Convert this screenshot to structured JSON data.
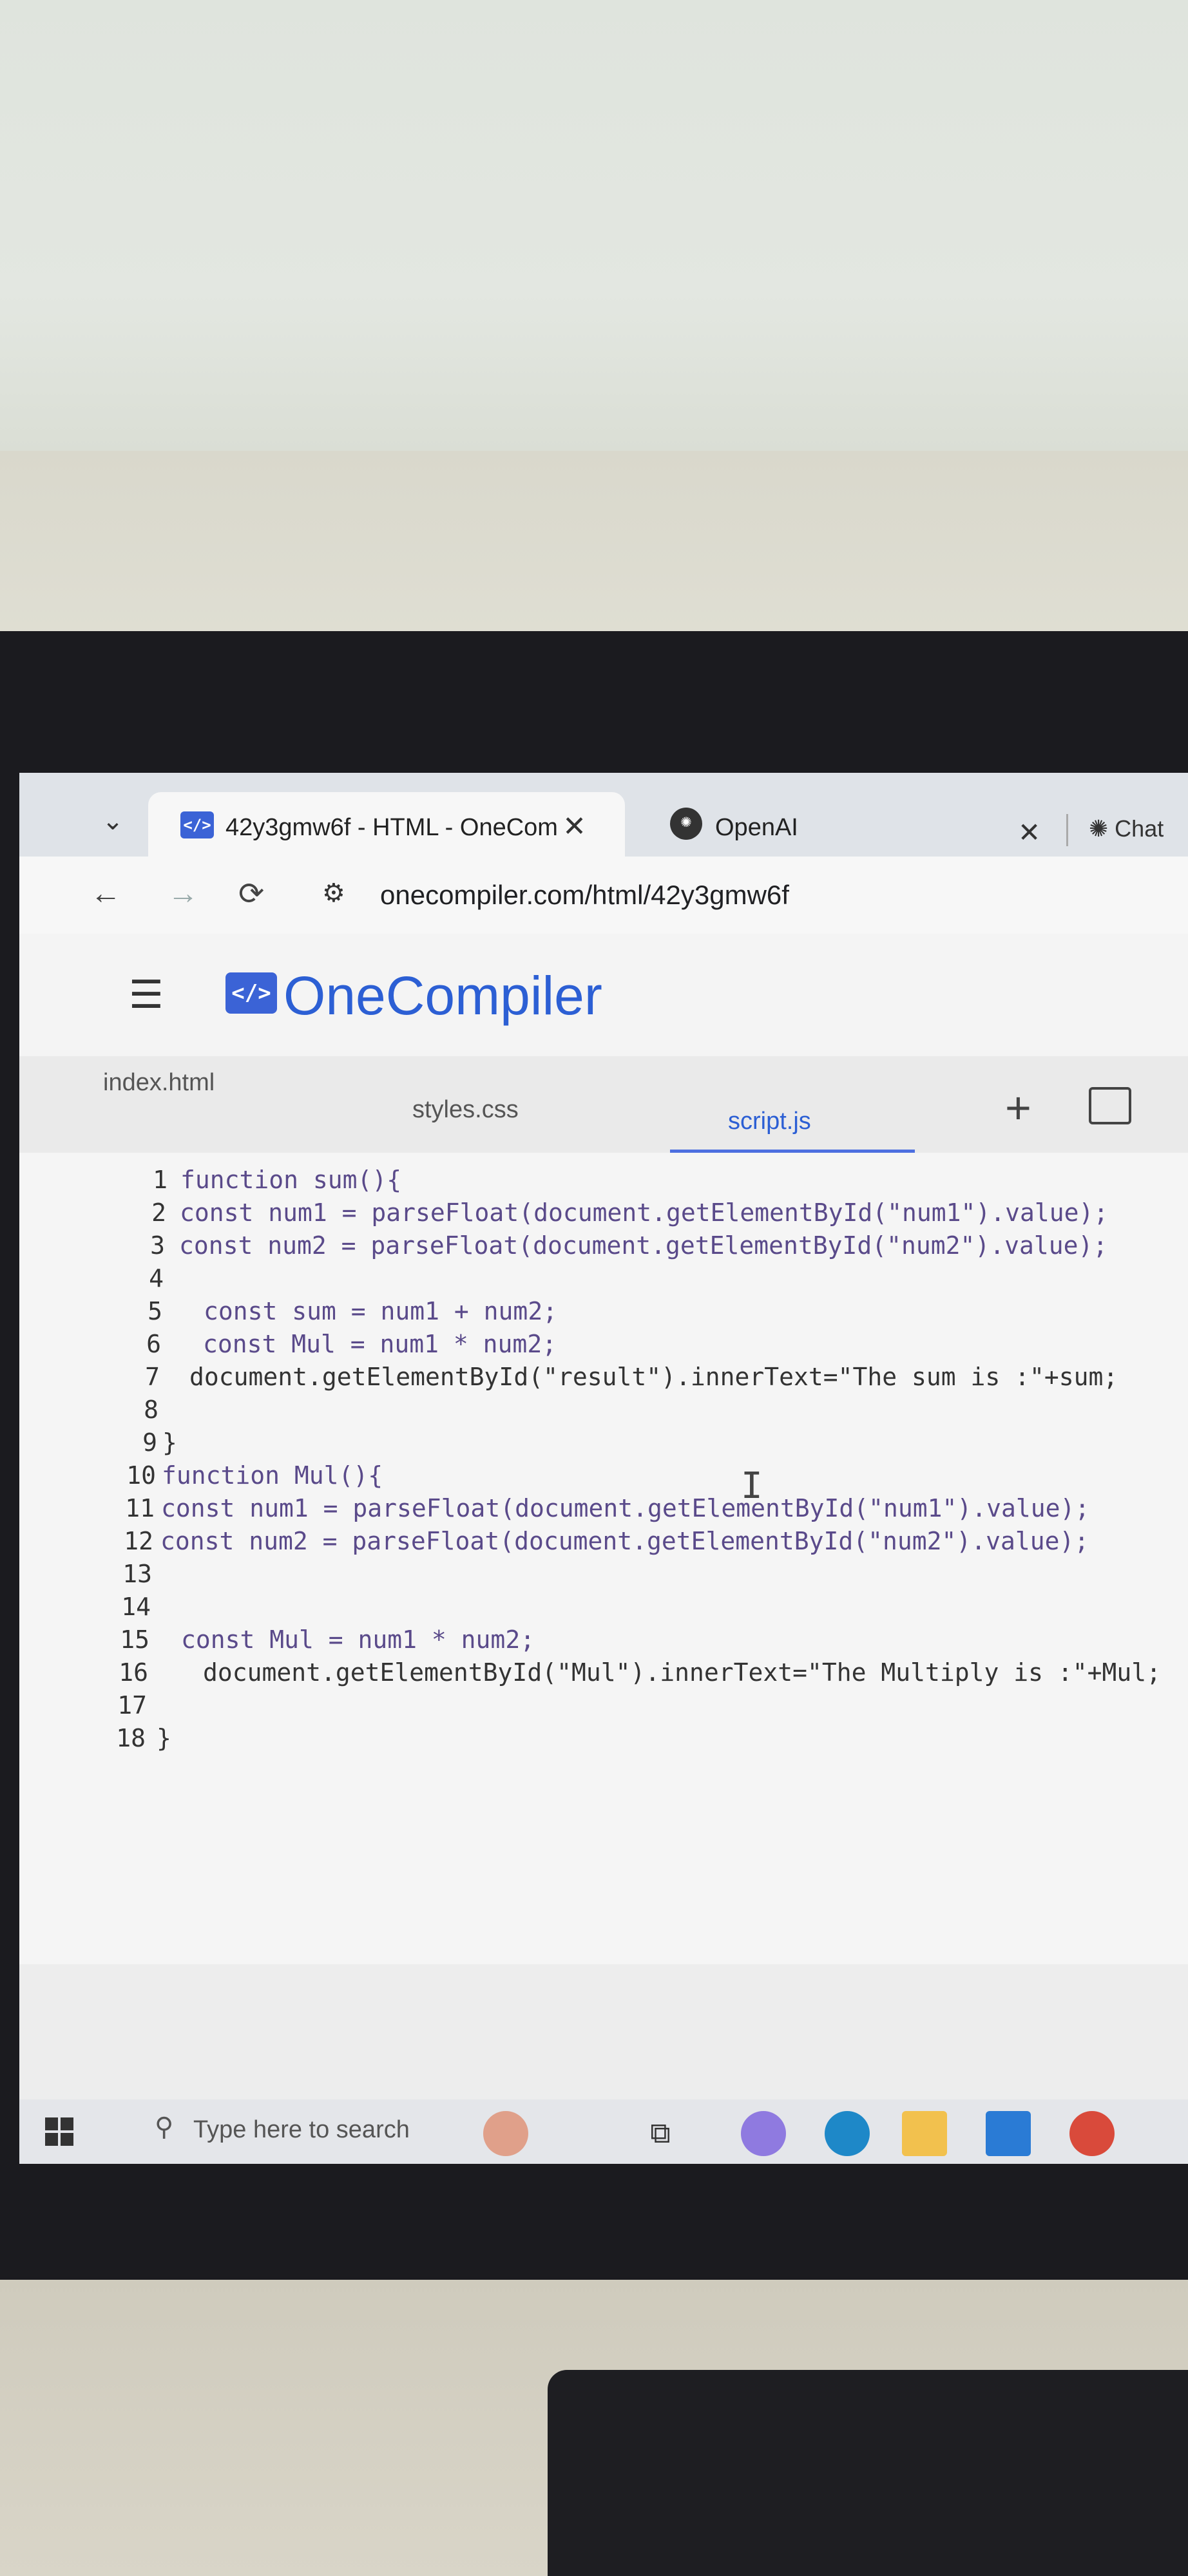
{
  "browser": {
    "tabs": [
      {
        "title": "42y3gmw6f - HTML - OneCom",
        "favicon": "</>"
      },
      {
        "title": "OpenAI",
        "favicon": "openai-logo"
      }
    ],
    "tab_peek": "Chat",
    "url": "onecompiler.com/html/42y3gmw6f"
  },
  "app": {
    "logo_mark": "</>",
    "name": "OneCompiler"
  },
  "file_tabs": [
    "index.html",
    "styles.css",
    "script.js"
  ],
  "active_file": "script.js",
  "code_lines": [
    {
      "n": "1",
      "text": "function sum(){"
    },
    {
      "n": "2",
      "text": "const num1 = parseFloat(document.getElementById(\"num1\").value);"
    },
    {
      "n": "3",
      "text": "const num2 = parseFloat(document.getElementById(\"num2\").value);"
    },
    {
      "n": "4",
      "text": ""
    },
    {
      "n": "5",
      "text": "const sum = num1 + num2;"
    },
    {
      "n": "6",
      "text": "const Mul = num1 * num2;"
    },
    {
      "n": "7",
      "text": "document.getElementById(\"result\").innerText=\"The sum is :\"+sum;"
    },
    {
      "n": "8",
      "text": ""
    },
    {
      "n": "9",
      "text": "}"
    },
    {
      "n": "10",
      "text": "function Mul(){"
    },
    {
      "n": "11",
      "text": "const num1 = parseFloat(document.getElementById(\"num1\").value);"
    },
    {
      "n": "12",
      "text": "const num2 = parseFloat(document.getElementById(\"num2\").value);"
    },
    {
      "n": "13",
      "text": ""
    },
    {
      "n": "14",
      "text": ""
    },
    {
      "n": "15",
      "text": "const Mul = num1 * num2;"
    },
    {
      "n": "16",
      "text": "document.getElementById(\"Mul\").innerText=\"The Multiply is :\"+Mul;"
    },
    {
      "n": "17",
      "text": ""
    },
    {
      "n": "18",
      "text": "}"
    }
  ],
  "taskbar": {
    "search_placeholder": "Type here to search"
  },
  "colors": {
    "accent": "#2c5fd4",
    "keyword": "#a13fa1",
    "string": "#2a6fa8"
  }
}
